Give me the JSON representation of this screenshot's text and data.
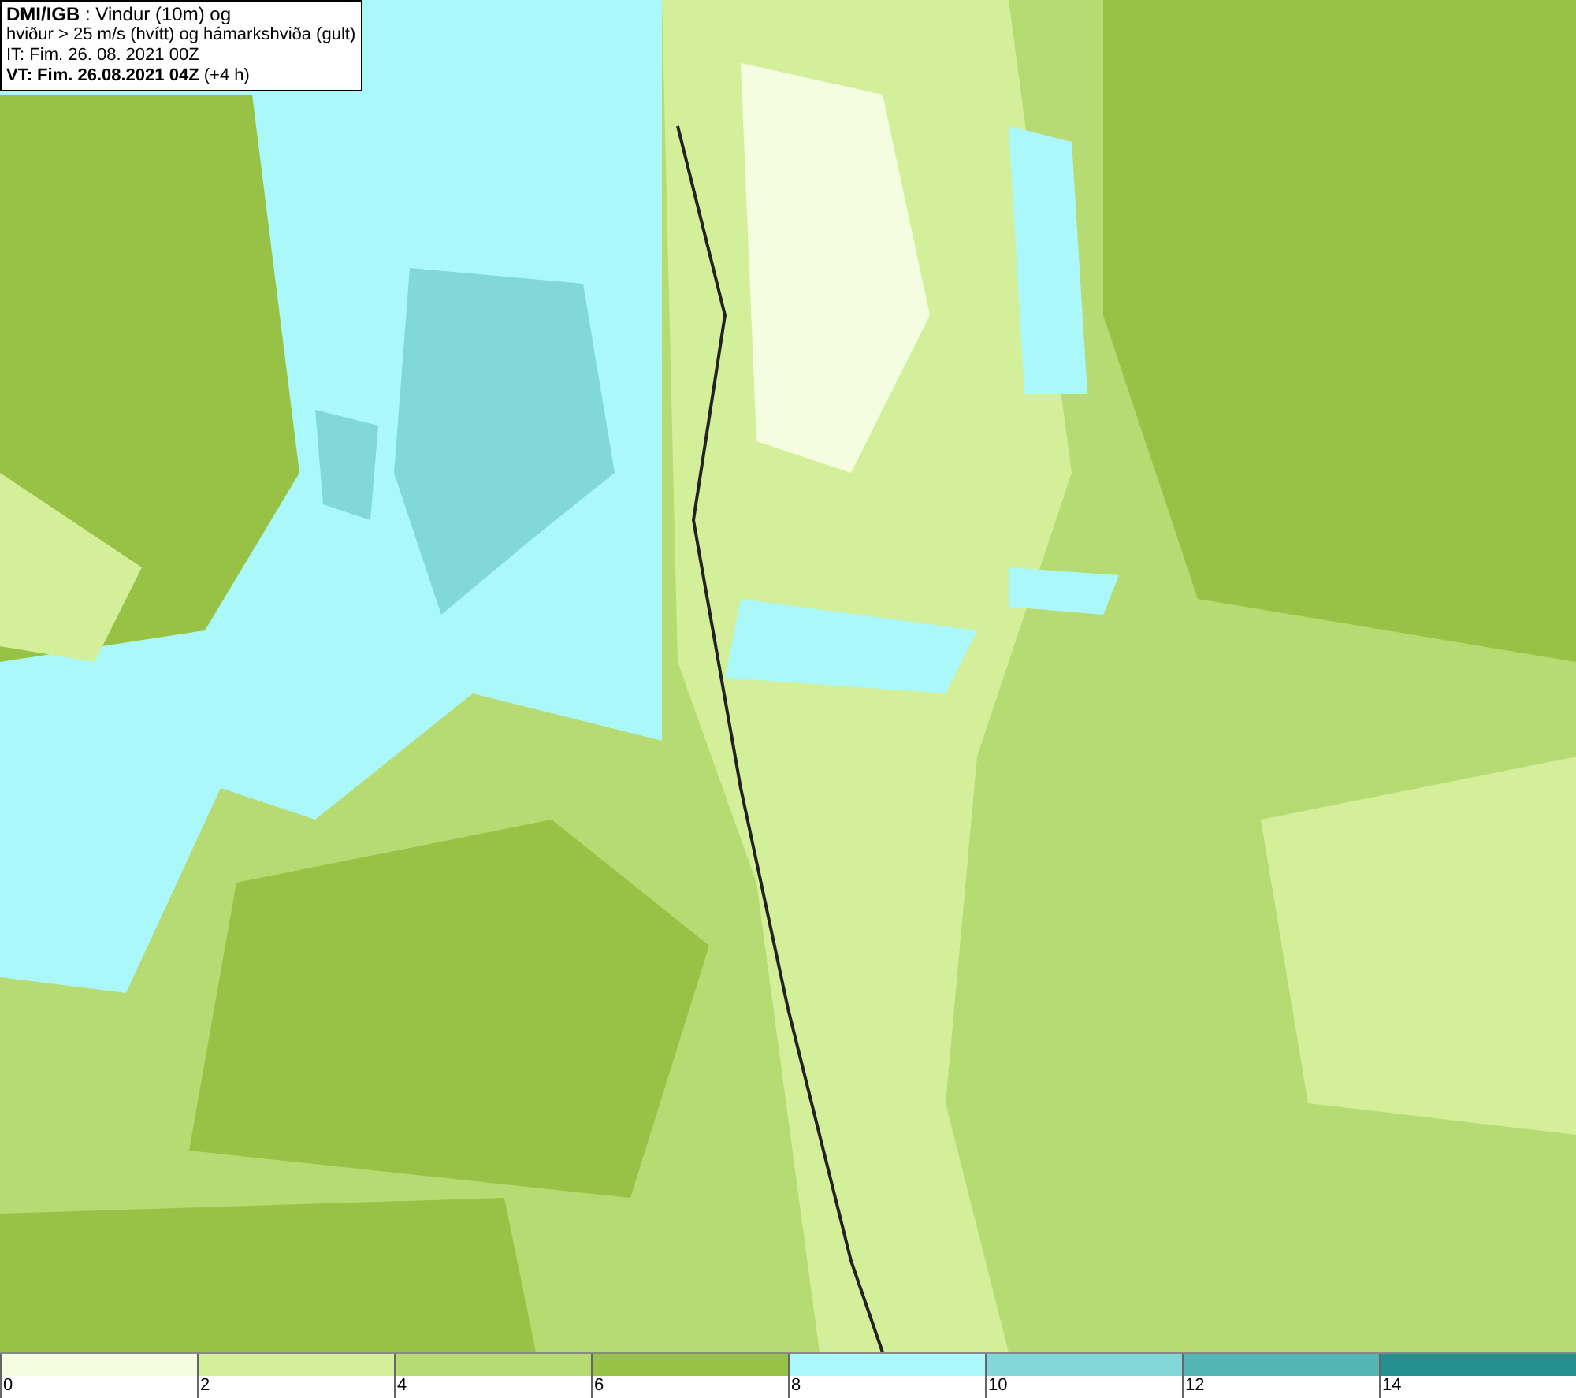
{
  "info_box": {
    "lines": [
      "**DMI/IGB** : Vindur (10m) og",
      "hviður > 25 m/s (hvítt) og hámarkshviða (gult)",
      "IT: Fim. 26. 08. 2021 00Z",
      "**VT: Fim. 26.08.2021 04Z** (+4 h)"
    ]
  },
  "legend": [
    {
      "label": "0",
      "color": "#f5fde0"
    },
    {
      "label": "2",
      "color": "#d3ef9a"
    },
    {
      "label": "4",
      "color": "#b6db72"
    },
    {
      "label": "6",
      "color": "#98c246"
    },
    {
      "label": "8",
      "color": "#aaf8fa"
    },
    {
      "label": "10",
      "color": "#82d8d8"
    },
    {
      "label": "12",
      "color": "#55b4b4"
    },
    {
      "label": "14",
      "color": "#259090"
    }
  ]
}
